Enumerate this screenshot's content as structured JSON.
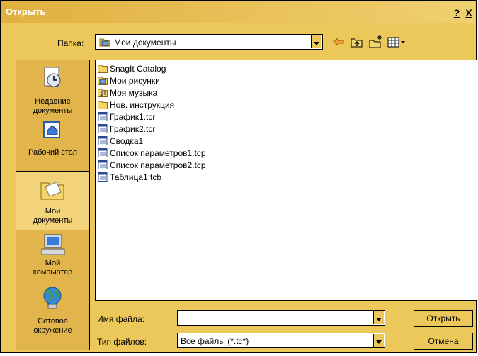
{
  "window": {
    "title": "Открыть",
    "help_label": "?",
    "close_label": "X"
  },
  "lookin": {
    "label": "Папка:",
    "value": "Мои документы"
  },
  "places": [
    {
      "label": "Недавние\nдокументы"
    },
    {
      "label": "Рабочий стол"
    },
    {
      "label": "Мои\nдокументы"
    },
    {
      "label": "Мой\nкомпьютер"
    },
    {
      "label": "Сетевое\nокружение"
    }
  ],
  "files": [
    {
      "name": "SnagIt Catalog",
      "icon": "folder-icon"
    },
    {
      "name": "Мои рисунки",
      "icon": "pictures-folder-icon"
    },
    {
      "name": "Моя музыка",
      "icon": "music-folder-icon"
    },
    {
      "name": "Нов. инструкция",
      "icon": "folder-icon"
    },
    {
      "name": "График1.tcr",
      "icon": "document-icon"
    },
    {
      "name": "График2.tcr",
      "icon": "document-icon"
    },
    {
      "name": "Сводка1",
      "icon": "document-icon"
    },
    {
      "name": "Список параметров1.tcp",
      "icon": "document-icon"
    },
    {
      "name": "Список параметров2.tcp",
      "icon": "document-icon"
    },
    {
      "name": "Таблица1.tcb",
      "icon": "document-icon"
    }
  ],
  "filename": {
    "label": "Имя файла:",
    "value": ""
  },
  "filetype": {
    "label": "Тип файлов:",
    "value": "Все файлы (*.tc*)"
  },
  "buttons": {
    "open": "Открыть",
    "cancel": "Отмена"
  },
  "colors": {
    "chrome": "#ECC85A",
    "places_bar": "#E2B44C",
    "selected_place": "#F2D27A",
    "folder": "#F5D56A"
  }
}
